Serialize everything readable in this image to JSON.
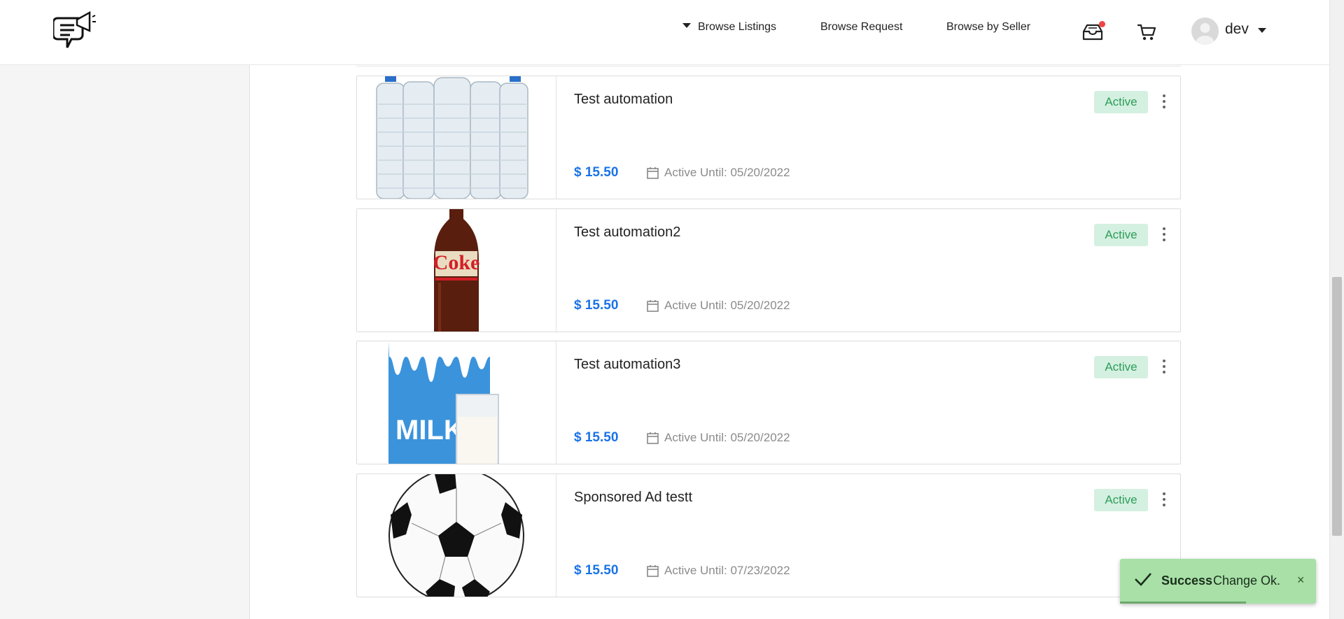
{
  "header": {
    "nav": {
      "browse_listings": "Browse Listings",
      "browse_request": "Browse Request",
      "browse_by_seller": "Browse by Seller"
    },
    "user": {
      "name": "dev"
    }
  },
  "listings": [
    {
      "title": "Test automation",
      "price": "$ 15.50",
      "active_until": "Active Until: 05/20/2022",
      "status": "Active",
      "image": "water-bottles"
    },
    {
      "title": "Test automation2",
      "price": "$ 15.50",
      "active_until": "Active Until: 05/20/2022",
      "status": "Active",
      "image": "coke-bottle"
    },
    {
      "title": "Test automation3",
      "price": "$ 15.50",
      "active_until": "Active Until: 05/20/2022",
      "status": "Active",
      "image": "milk-carton"
    },
    {
      "title": "Sponsored Ad testt",
      "price": "$ 15.50",
      "active_until": "Active Until: 07/23/2022",
      "status": "Active",
      "image": "soccer-ball"
    }
  ],
  "toast": {
    "title": "Success",
    "message": "Change Ok.",
    "close": "×"
  },
  "colors": {
    "price": "#1a73e8",
    "badge_bg": "#d4f0e0",
    "badge_text": "#2e9d5b",
    "toast_bg": "#a8e0a8"
  }
}
